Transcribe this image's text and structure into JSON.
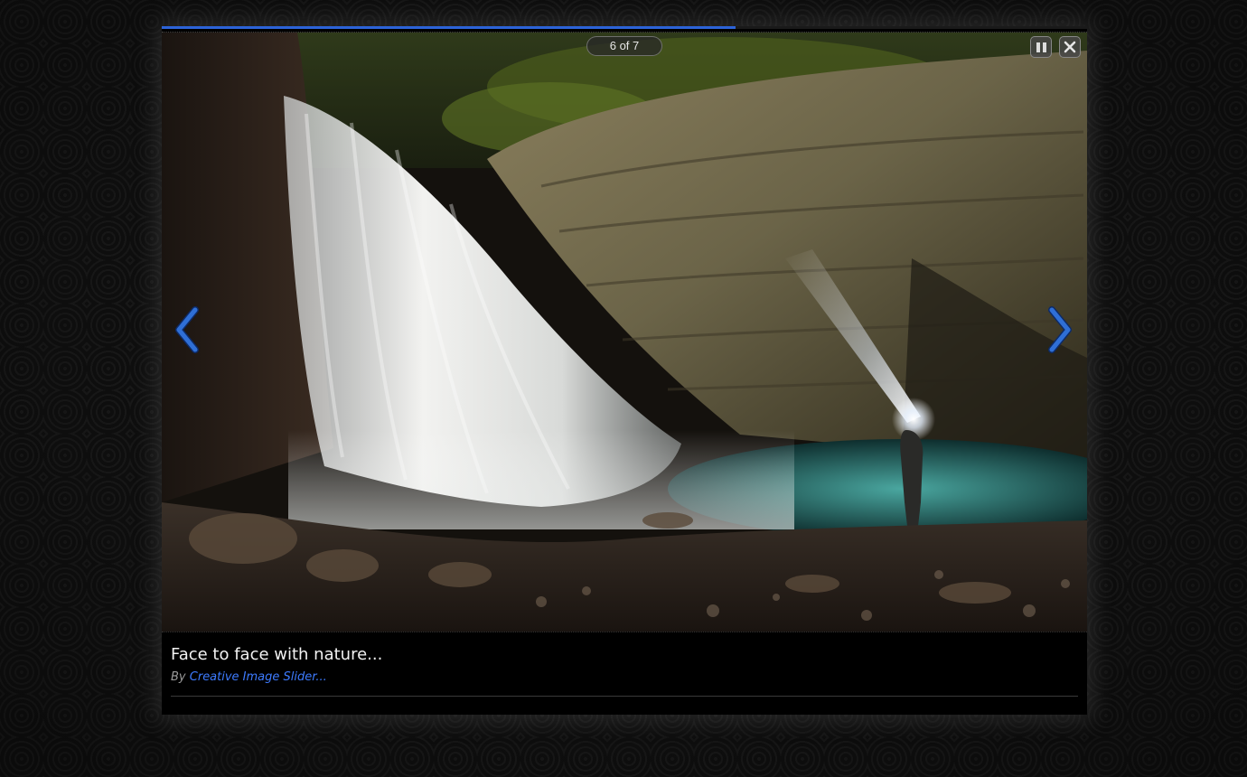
{
  "slideshow": {
    "counter": "6 of 7",
    "progress_fraction": 0.62,
    "pause_icon": "pause-icon",
    "close_icon": "close-icon",
    "prev_icon": "chevron-left-icon",
    "next_icon": "chevron-right-icon"
  },
  "caption": {
    "title": "Face to face with nature...",
    "by_prefix": "By",
    "author_link": "Creative Image Slider..."
  },
  "colors": {
    "accent": "#2c63d8",
    "link": "#3d7bff",
    "arrow": "#2f6fd6"
  }
}
